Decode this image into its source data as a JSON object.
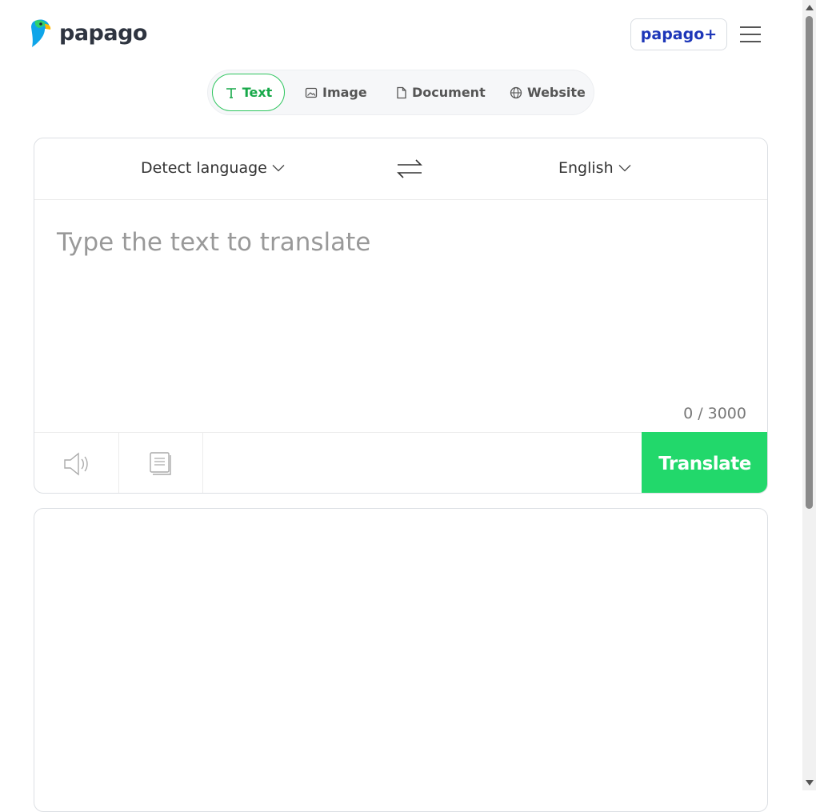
{
  "header": {
    "logo_text": "papago",
    "plus_button_label": "papago+"
  },
  "tabs": [
    {
      "label": "Text",
      "icon": "text-icon",
      "active": true
    },
    {
      "label": "Image",
      "icon": "image-icon",
      "active": false
    },
    {
      "label": "Document",
      "icon": "document-icon",
      "active": false
    },
    {
      "label": "Website",
      "icon": "globe-icon",
      "active": false
    }
  ],
  "source": {
    "language": "Detect language",
    "placeholder": "Type the text to translate",
    "value": "",
    "counter": "0 / 3000"
  },
  "target": {
    "language": "English"
  },
  "toolbar": {
    "speaker_icon": "speaker-icon",
    "copy_icon": "copy-icon",
    "translate_label": "Translate"
  },
  "colors": {
    "accent_green": "#22d86b",
    "active_tab_green": "#18a94a",
    "plus_blue": "#1d36b8"
  }
}
